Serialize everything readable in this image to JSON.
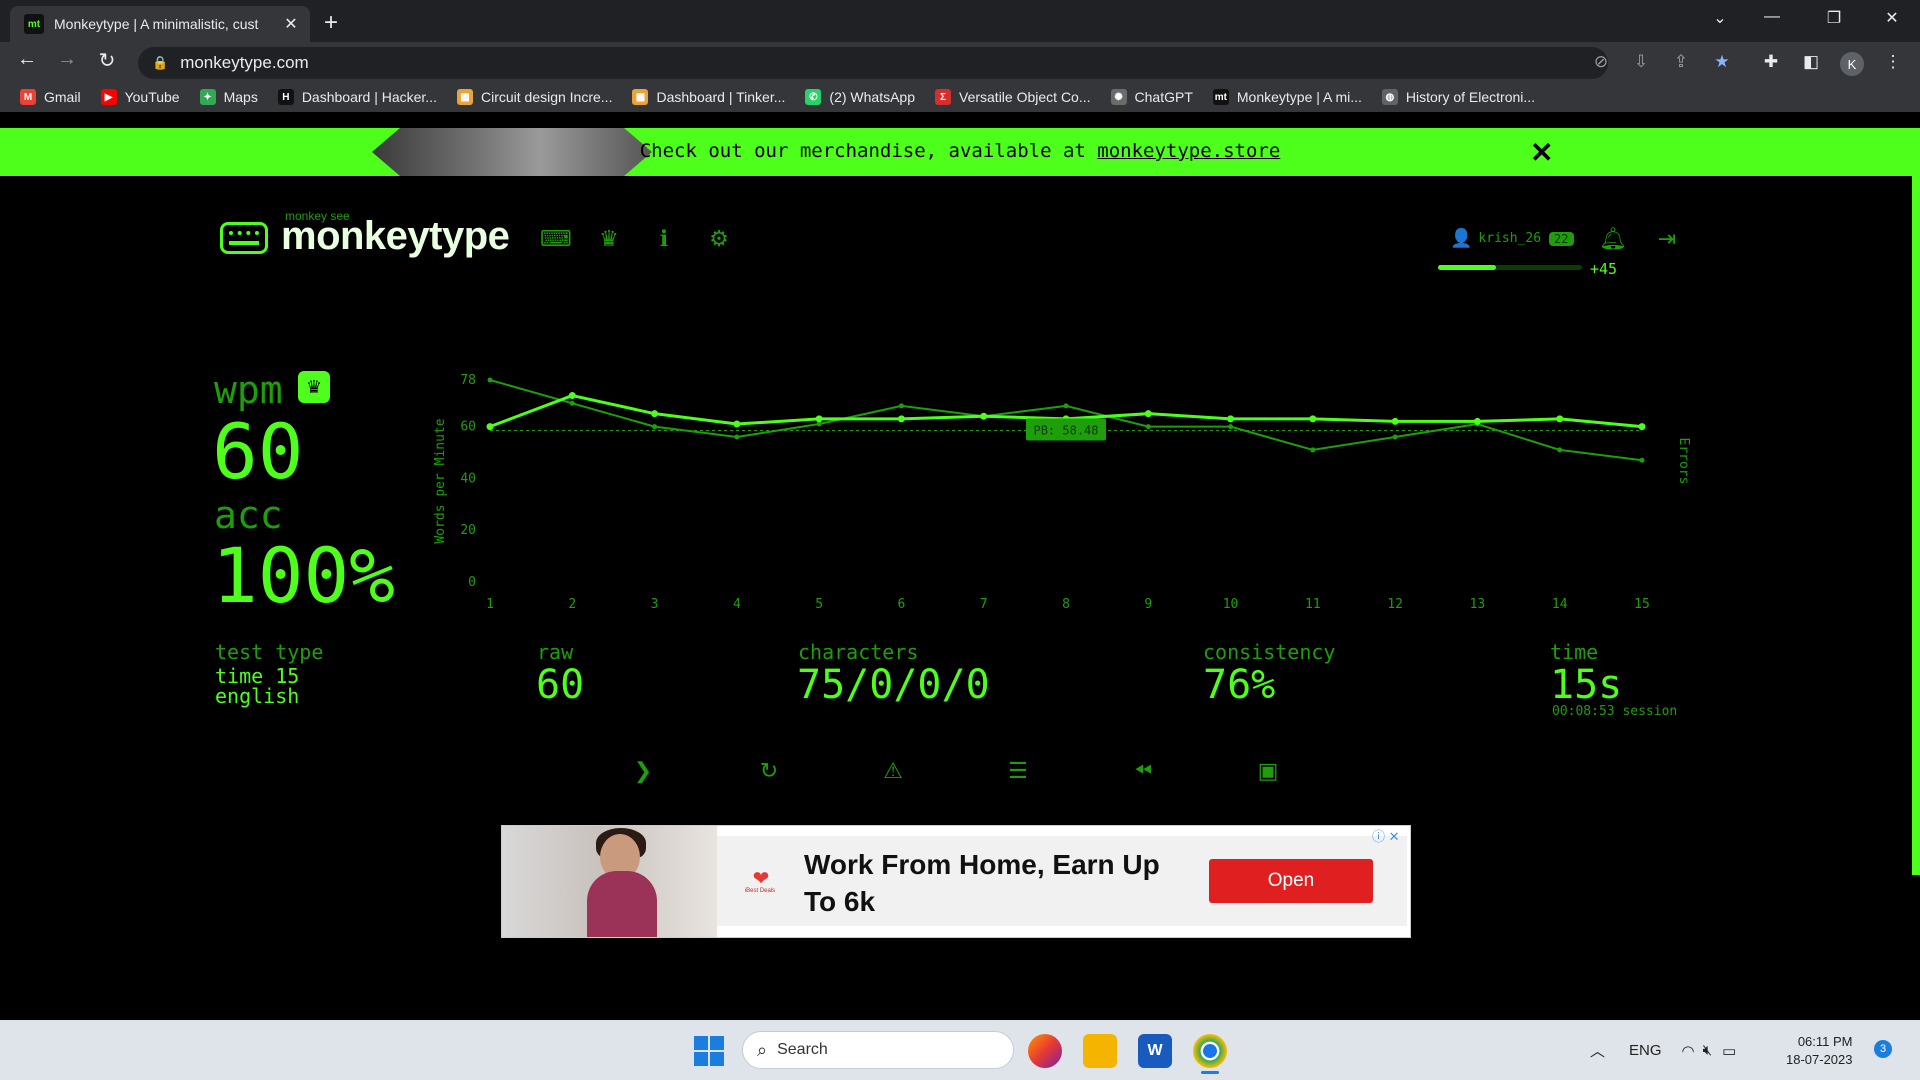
{
  "browser": {
    "tab_title": "Monkeytype | A minimalistic, cust",
    "tab_favicon": "mt",
    "url": "monkeytype.com",
    "profile_initial": "K",
    "bookmarks": [
      {
        "label": "Gmail",
        "icon": "gmail-icon",
        "color": "#ea4335",
        "glyph": "M"
      },
      {
        "label": "YouTube",
        "icon": "youtube-icon",
        "color": "#ff0000",
        "glyph": "▶"
      },
      {
        "label": "Maps",
        "icon": "maps-icon",
        "color": "#34a853",
        "glyph": "✦"
      },
      {
        "label": "Dashboard | Hacker...",
        "icon": "hackerrank-icon",
        "color": "#111111",
        "glyph": "H"
      },
      {
        "label": "Circuit design Incre...",
        "icon": "tinkercad-icon",
        "color": "#e8a33c",
        "glyph": "▦"
      },
      {
        "label": "Dashboard | Tinker...",
        "icon": "tinkercad-icon",
        "color": "#e8a33c",
        "glyph": "▦"
      },
      {
        "label": "(2) WhatsApp",
        "icon": "whatsapp-icon",
        "color": "#25d366",
        "glyph": "✆"
      },
      {
        "label": "Versatile Object Co...",
        "icon": "sigma-icon",
        "color": "#d32f2f",
        "glyph": "Σ"
      },
      {
        "label": "ChatGPT",
        "icon": "chatgpt-icon",
        "color": "#6b6b6b",
        "glyph": "✺"
      },
      {
        "label": "Monkeytype | A mi...",
        "icon": "monkeytype-icon",
        "color": "#111111",
        "glyph": "mt"
      },
      {
        "label": "History of Electroni...",
        "icon": "globe-icon",
        "color": "#5f6368",
        "glyph": "◍"
      }
    ]
  },
  "banner": {
    "text": "Check out our merchandise, available at ",
    "link": "monkeytype.store"
  },
  "header": {
    "logo_small": "monkey see",
    "logo": "monkeytype",
    "username": "krish_26",
    "level": "22",
    "xp_gain": "+45",
    "xp_progress": 0.4
  },
  "stats": {
    "wpm_label": "wpm",
    "wpm": "60",
    "acc_label": "acc",
    "acc": "100%",
    "test_type_label": "test type",
    "test_type_line1": "time 15",
    "test_type_line2": "english",
    "raw_label": "raw",
    "raw": "60",
    "characters_label": "characters",
    "characters": "75/0/0/0",
    "consistency_label": "consistency",
    "consistency": "76%",
    "time_label": "time",
    "time": "15s",
    "session": "00:08:53 session"
  },
  "chart_data": {
    "type": "line",
    "x": [
      1,
      2,
      3,
      4,
      5,
      6,
      7,
      8,
      9,
      10,
      11,
      12,
      13,
      14,
      15
    ],
    "ylabel": "Words per Minute",
    "y2label": "Errors",
    "ylim": [
      0,
      78
    ],
    "yticks": [
      0,
      20,
      40,
      60,
      78
    ],
    "pb_label": "PB: 58.48",
    "pb_value": 58.48,
    "series": [
      {
        "values": [
          60,
          72,
          65,
          61,
          63,
          63,
          64,
          63,
          65,
          63,
          63,
          62,
          62,
          63,
          60
        ],
        "color": "#4dff1a"
      },
      {
        "values": [
          78,
          69,
          60,
          56,
          61,
          68,
          64,
          68,
          60,
          60,
          51,
          56,
          61,
          51,
          47
        ],
        "color": "#1f9e0b"
      }
    ]
  },
  "ad": {
    "headline": "Work From Home, Earn Up To 6k",
    "button": "Open",
    "brand": "iBest Deals"
  },
  "taskbar": {
    "search_placeholder": "Search",
    "lang": "ENG",
    "time": "06:11 PM",
    "date": "18-07-2023",
    "notifications": "3"
  }
}
